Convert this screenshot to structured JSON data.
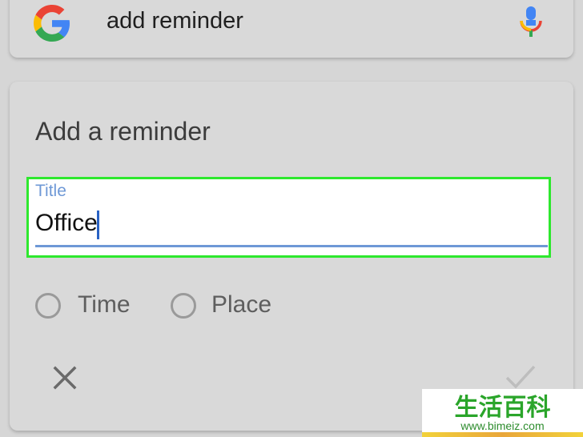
{
  "search": {
    "query": "add reminder",
    "logo_icon": "google-g-icon",
    "mic_icon": "microphone-icon"
  },
  "reminder": {
    "heading": "Add a reminder",
    "title_field": {
      "label": "Title",
      "value": "Office"
    },
    "options": [
      {
        "label": "Time",
        "icon": "radio-unselected-icon"
      },
      {
        "label": "Place",
        "icon": "radio-unselected-icon"
      }
    ],
    "cancel_icon": "close-icon",
    "confirm_icon": "checkmark-icon"
  },
  "watermark": {
    "text": "生活百科",
    "url": "www.bimeiz.com"
  },
  "colors": {
    "highlight": "#2ee82e",
    "accent": "#6e98d6",
    "caret": "#2962c4",
    "background": "#d6d6d6"
  }
}
